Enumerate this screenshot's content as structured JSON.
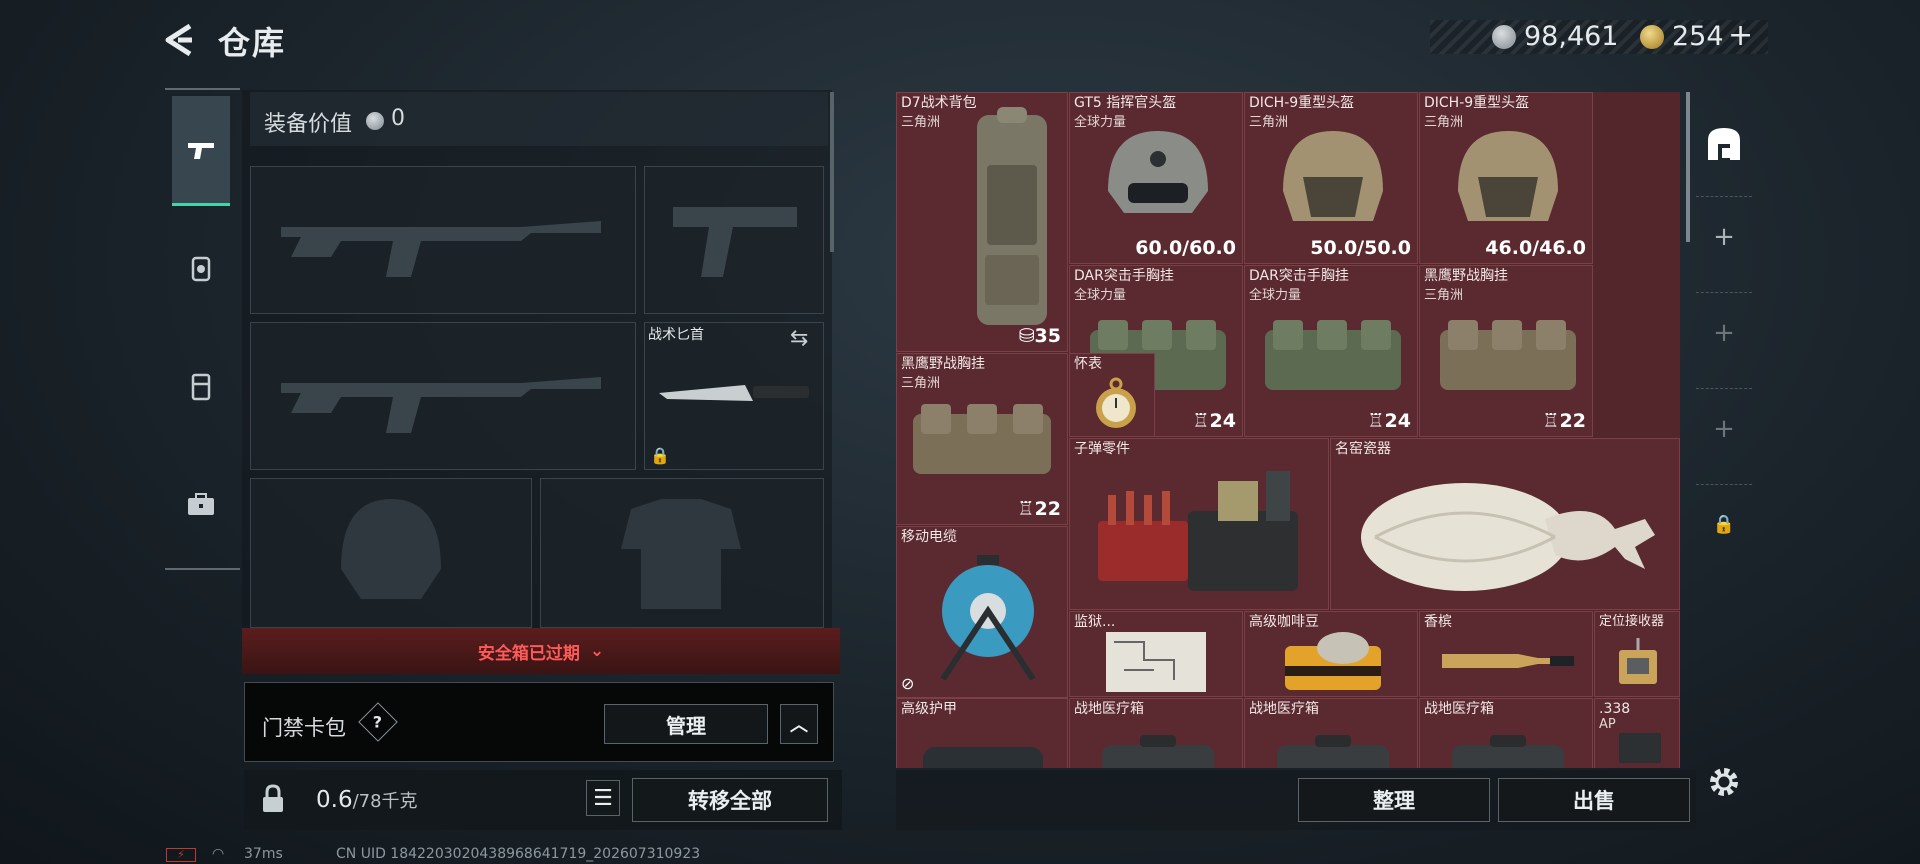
{
  "header": {
    "title": "仓库"
  },
  "currency": {
    "silver": "98,461",
    "gold": "254"
  },
  "equipment": {
    "value_label": "装备价值",
    "value": "0",
    "knife_label": "战术匕首"
  },
  "safe_box": {
    "status": "安全箱已过期"
  },
  "keycard": {
    "label": "门禁卡包",
    "help": "?",
    "manage": "管理",
    "collapse": "^"
  },
  "weight": {
    "current": "0.6",
    "max_unit": "/78千克"
  },
  "transfer_all": "转移全部",
  "inventory": {
    "items": [
      {
        "name": "D7战术背包",
        "sub": "三角洲",
        "value": "35",
        "value_icon": "bag-icon"
      },
      {
        "name": "GT5 指挥官头盔",
        "sub": "全球力量",
        "value": "60.0/60.0"
      },
      {
        "name": "DICH-9重型头盔",
        "sub": "三角洲",
        "value": "50.0/50.0"
      },
      {
        "name": "DICH-9重型头盔",
        "sub": "三角洲",
        "value": "46.0/46.0"
      },
      {
        "name": "DAR突击手胸挂",
        "sub": "全球力量",
        "value": "24",
        "value_icon": "vest-icon"
      },
      {
        "name": "DAR突击手胸挂",
        "sub": "全球力量",
        "value": "24",
        "value_icon": "vest-icon"
      },
      {
        "name": "黑鹰野战胸挂",
        "sub": "三角洲",
        "value": "22",
        "value_icon": "vest-icon"
      },
      {
        "name": "黑鹰野战胸挂",
        "sub": "三角洲",
        "value": "22",
        "value_icon": "vest-icon"
      },
      {
        "name": "怀表",
        "sub": "",
        "value": ""
      },
      {
        "name": "子弹零件",
        "sub": "",
        "value": ""
      },
      {
        "name": "名窑瓷器",
        "sub": "",
        "value": ""
      },
      {
        "name": "移动电缆",
        "sub": "",
        "value": ""
      },
      {
        "name": "监狱...",
        "sub": "",
        "value": ""
      },
      {
        "name": "高级咖啡豆",
        "sub": "",
        "value": ""
      },
      {
        "name": "香槟",
        "sub": "",
        "value": ""
      },
      {
        "name": "定位接收器",
        "sub": "",
        "value": ""
      },
      {
        "name": "高级护甲",
        "sub": "",
        "value": ""
      },
      {
        "name": "战地医疗箱",
        "sub": "",
        "value": ""
      },
      {
        "name": "战地医疗箱",
        "sub": "",
        "value": ""
      },
      {
        "name": "战地医疗箱",
        "sub": "",
        "value": ""
      },
      {
        "name": ".338",
        "sub": "AP",
        "value": ""
      }
    ]
  },
  "actions": {
    "sort": "整理",
    "sell": "出售"
  },
  "status_bar": {
    "ping": "37ms",
    "uid": "CN UID 1842203020438968641719_202607310923"
  },
  "colors": {
    "accent": "#45d3a9",
    "cell_bg": "#5a2a30",
    "warning": "#ff5a5a"
  }
}
